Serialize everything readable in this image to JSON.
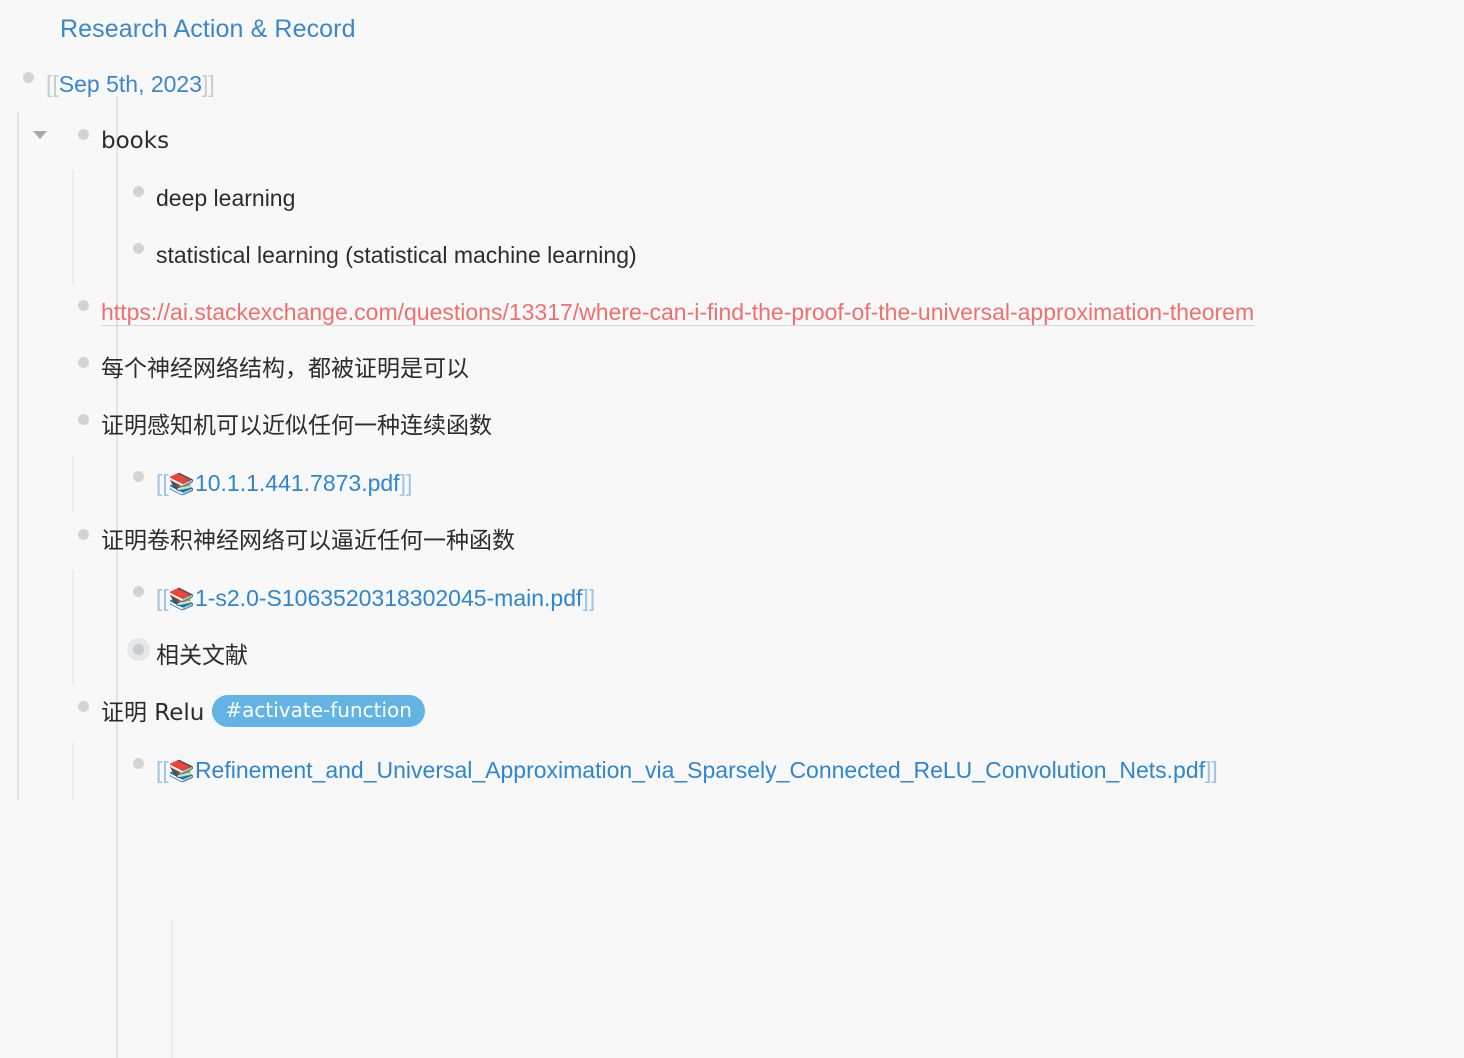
{
  "page": {
    "title": "Research Action & Record",
    "title_color": "#3a87cd",
    "background": "#f8f8f8"
  },
  "outline": {
    "date_node": {
      "bracket_open": "[[",
      "label": "Sep 5th, 2023",
      "bracket_close": "]]"
    },
    "books_node": {
      "label": "books",
      "expanded": true,
      "children": [
        {
          "label": "deep learning"
        },
        {
          "label": "statistical learning (statistical machine learning)"
        }
      ]
    },
    "url_node": {
      "url": "https://ai.stackexchange.com/questions/13317/where-can-i-find-the-proof-of-the-universal-approximation-theorem",
      "color": "#f0706d"
    },
    "note_1": {
      "label": "每个神经网络结构，都被证明是可以"
    },
    "note_2": {
      "label": "证明感知机可以近似任何一种连续函数",
      "children": [
        {
          "bracket_open": "[[",
          "icon": "books-emoji",
          "icon_glyph": "📚",
          "label": "10.1.1.441.7873.pdf",
          "bracket_close": "]]"
        }
      ]
    },
    "note_3": {
      "label": "证明卷积神经网络可以逼近任何一种函数",
      "children": [
        {
          "bracket_open": "[[",
          "icon": "books-emoji",
          "icon_glyph": "📚",
          "label": "1-s2.0-S1063520318302045-main.pdf",
          "bracket_close": "]]"
        },
        {
          "label": "相关文献",
          "collapsed": true
        }
      ]
    },
    "note_4": {
      "label": "证明 Relu",
      "tag": "#activate-function",
      "tag_color": "#63b3e4",
      "children": [
        {
          "bracket_open": "[[",
          "icon": "books-emoji",
          "icon_glyph": "📚",
          "label": "Refinement_and_Universal_Approximation_via_Sparsely_Connected_ReLU_Convolution_Nets.pdf",
          "bracket_close": "]]"
        }
      ]
    }
  }
}
